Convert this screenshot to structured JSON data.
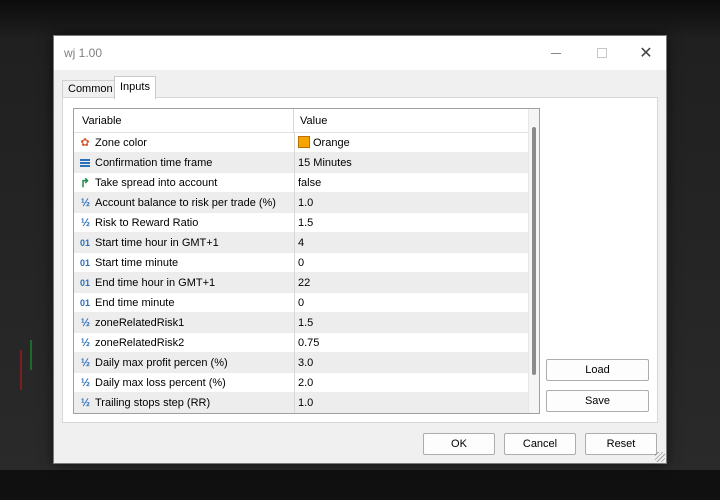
{
  "window": {
    "title": "wj 1.00"
  },
  "tabs": [
    {
      "label": "Common",
      "active": false
    },
    {
      "label": "Inputs",
      "active": true
    }
  ],
  "grid": {
    "columns": {
      "variable": "Variable",
      "value": "Value"
    },
    "rows": [
      {
        "icon": "color-icon",
        "name": "Zone color",
        "value": "Orange",
        "swatch": "#f5a400"
      },
      {
        "icon": "enum-icon",
        "name": "Confirmation time frame",
        "value": "15 Minutes"
      },
      {
        "icon": "bool-icon",
        "name": "Take spread into account",
        "value": "false"
      },
      {
        "icon": "double-icon",
        "name": "Account balance to risk per trade (%)",
        "value": "1.0"
      },
      {
        "icon": "double-icon",
        "name": "Risk to Reward Ratio",
        "value": "1.5"
      },
      {
        "icon": "int-icon",
        "name": "Start time hour in GMT+1",
        "value": "4"
      },
      {
        "icon": "int-icon",
        "name": "Start time minute",
        "value": "0"
      },
      {
        "icon": "int-icon",
        "name": "End time hour in GMT+1",
        "value": "22"
      },
      {
        "icon": "int-icon",
        "name": "End time minute",
        "value": "0"
      },
      {
        "icon": "double-icon",
        "name": "zoneRelatedRisk1",
        "value": "1.5"
      },
      {
        "icon": "double-icon",
        "name": "zoneRelatedRisk2",
        "value": "0.75"
      },
      {
        "icon": "double-icon",
        "name": "Daily max profit percen (%)",
        "value": "3.0"
      },
      {
        "icon": "double-icon",
        "name": "Daily max loss percent (%)",
        "value": "2.0"
      },
      {
        "icon": "double-icon",
        "name": "Trailing stops step (RR)",
        "value": "1.0"
      }
    ]
  },
  "icon_glyphs": {
    "double": "½",
    "int": "01",
    "bool": "↱"
  },
  "buttons": {
    "load": "Load",
    "save": "Save",
    "ok": "OK",
    "cancel": "Cancel",
    "reset": "Reset"
  },
  "colors": {
    "accent": "#2b6fb8",
    "swatch_orange": "#f5a400"
  }
}
